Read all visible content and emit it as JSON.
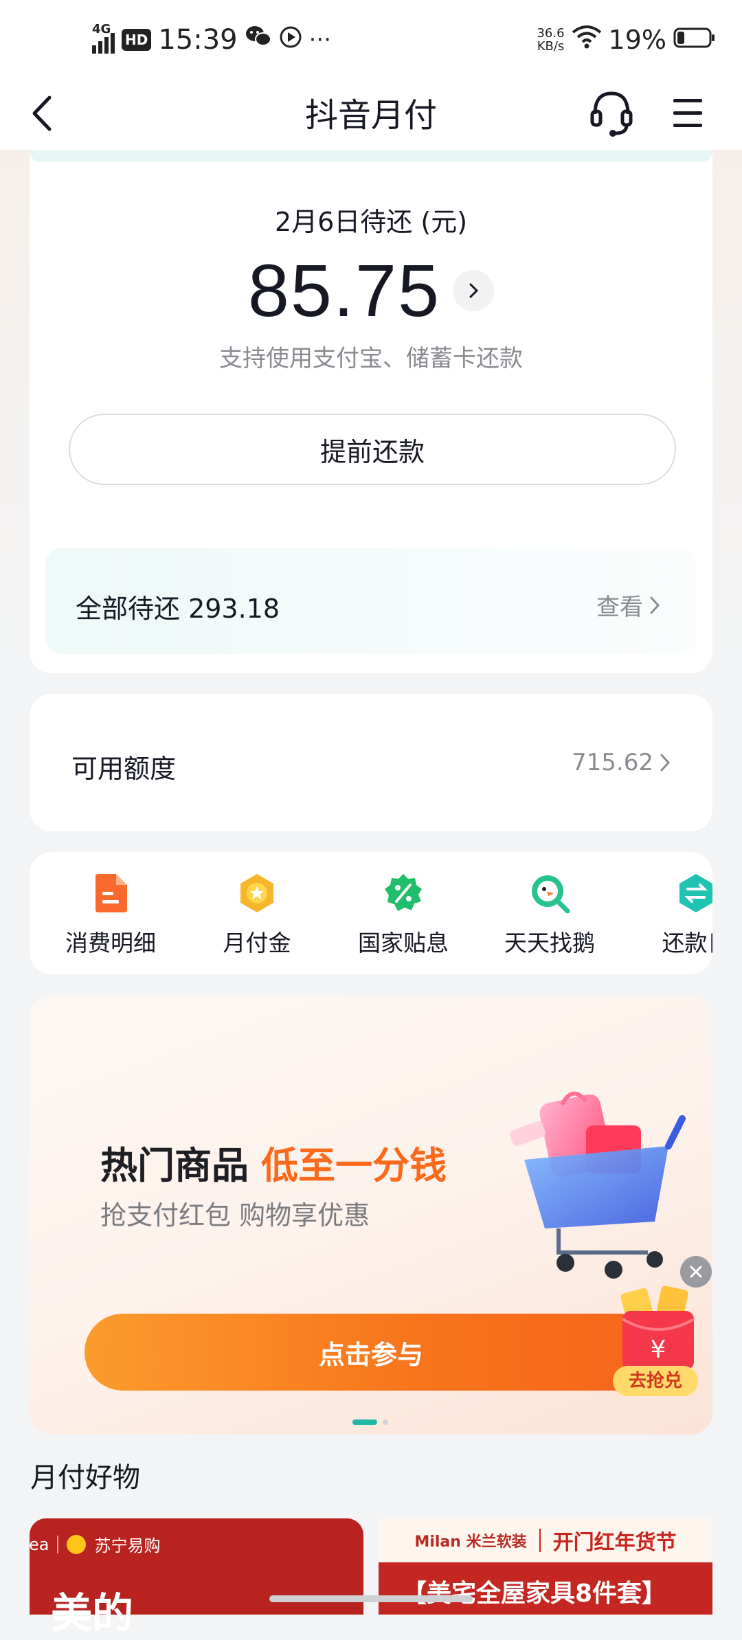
{
  "status_bar": {
    "network": "4G",
    "hd_badge": "HD",
    "time": "15:39",
    "more": "···",
    "net_speed_value": "36.6",
    "net_speed_unit": "KB/s",
    "battery": "19%"
  },
  "nav": {
    "title": "抖音月付"
  },
  "repayment": {
    "due_title": "2月6日待还 (元)",
    "amount": "85.75",
    "subtitle": "支持使用支付宝、储蓄卡还款",
    "prepay_button": "提前还款",
    "all_due_label": "全部待还 293.18",
    "view_link": "查看"
  },
  "quota": {
    "label": "可用额度",
    "value": "715.62"
  },
  "shortcuts": [
    {
      "label": "消费明细",
      "icon": "document-icon",
      "color": "#fa6a2c"
    },
    {
      "label": "月付金",
      "icon": "star-badge-icon",
      "color": "#f7b52c"
    },
    {
      "label": "国家贴息",
      "icon": "percent-badge-icon",
      "color": "#1fbe6a"
    },
    {
      "label": "天天找鹅",
      "icon": "goose-search-icon",
      "color": "#27c38f"
    },
    {
      "label": "还款日",
      "icon": "exchange-icon",
      "color": "#20c3b2"
    }
  ],
  "banner": {
    "title_main": "热门商品",
    "title_highlight": "低至一分钱",
    "subtitle": "抢支付红包 购物享优惠",
    "cta": "点击参与",
    "float_label": "去抢兑",
    "float_symbol": "¥"
  },
  "products": {
    "section_title": "月付好物",
    "card1_brand": "苏宁易购",
    "card1_prefix": "ea",
    "card1_big": "美的",
    "card2_brand": "Milan 米兰软装",
    "card2_slogan": "开门红年货节",
    "card2_bottom": "【美宅全屋家具8件套】"
  }
}
